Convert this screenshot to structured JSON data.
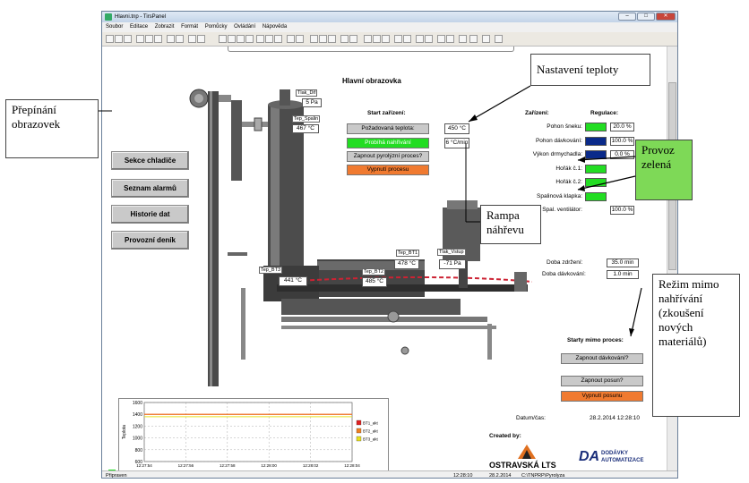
{
  "window": {
    "title": "Hlavni.tnp - TirsPanel"
  },
  "menu": [
    "Soubor",
    "Editace",
    "Zobrazit",
    "Formát",
    "Pomůcky",
    "Ovládání",
    "Nápověda"
  ],
  "screen_title": "Hlavní obrazovka",
  "nav_buttons": [
    "Sekce chladiče",
    "Seznam alarmů",
    "Historie dat",
    "Provozní deník"
  ],
  "start": {
    "heading": "Start zařízení:",
    "setpoint_label": "Požadovaná teplota:",
    "setpoint_value": "450 °C",
    "heating_label": "Probíhá nahřívání",
    "ramp_value": "6 °C/min",
    "pyrolysis_label": "Zapnout pyrolýzní proces?",
    "stop_label": "Vypnutí procesu"
  },
  "devices": {
    "col1": "Zařízení:",
    "col2": "Regulace:",
    "rows": [
      {
        "name": "Pohon šneku:",
        "state": "green",
        "value": "20.0 %"
      },
      {
        "name": "Pohon dávkování:",
        "state": "blue",
        "value": "100.0 %"
      },
      {
        "name": "Výkon drmychadla:",
        "state": "blue",
        "value": "0.0 %"
      },
      {
        "name": "Hořák č.1:",
        "state": "green",
        "value": ""
      },
      {
        "name": "Hořák č.2:",
        "state": "green",
        "value": ""
      },
      {
        "name": "Spalinová klapka:",
        "state": "green",
        "value": ""
      },
      {
        "name": "Spal. ventilátor:",
        "state": "",
        "value": "100.0 %"
      }
    ]
  },
  "times": {
    "hold_label": "Doba zdržení:",
    "hold_value": "35.0 min",
    "dose_label": "Doba dávkování:",
    "dose_value": "1.0 min"
  },
  "sensors": {
    "tlak_dif": "Tlak_Dif",
    "tlak_dif_value": "5 Pa",
    "tep_spalin": "Tep_Spalin",
    "tep_spalin_value": "467 °C",
    "tep_bt3": "Tep_BT3",
    "tep_bt3_value": "441 °C",
    "tep_bt2": "Tep_BT2",
    "tep_bt2_value": "485 °C",
    "tep_bt1": "Tep_BT1",
    "tep_bt1_value": "478 °C",
    "tlak_vstup": "Tlak_Vstup",
    "tlak_vstup_value": "-71 Pa"
  },
  "off_process": {
    "heading": "Starty mimo proces:",
    "dose_btn": "Zapnout dávkování?",
    "shift_btn": "Zapnout posun?",
    "stop_shift_btn": "Vypnutí posunu"
  },
  "datetime": {
    "label": "Datum/čas:",
    "value": "28.2.2014 12:28:10"
  },
  "created_by": "Created by:",
  "logos": {
    "l1": "OSTRAVSKÁ LTS",
    "l2a": "DODÁVKY",
    "l2b": "AUTOMATIZACE"
  },
  "chart_data": {
    "type": "line",
    "ylabel": "Teplota",
    "ylim": [
      600,
      1600
    ],
    "yticks": [
      "600",
      "800",
      "1000",
      "1200",
      "1400",
      "1600"
    ],
    "xticks": [
      "12:27:54",
      "12:27:56",
      "12:27:58",
      "12:28:00",
      "12:28:02",
      "12:28:04"
    ],
    "series": [
      {
        "name": "BT1_akt",
        "color": "#e02020",
        "values": [
          1400,
          1400,
          1400,
          1400,
          1400,
          1400
        ]
      },
      {
        "name": "BT2_akt",
        "color": "#f08020",
        "values": [
          1400,
          1400,
          1400,
          1400,
          1400,
          1400
        ]
      },
      {
        "name": "BT3_akt",
        "color": "#e8e020",
        "values": [
          1360,
          1360,
          1360,
          1360,
          1360,
          1360
        ]
      }
    ]
  },
  "statusbar": {
    "left": "Připraven",
    "time": "12:28:10",
    "date": "28.2.2014",
    "path": "C:\\TNPRP\\Pyrolyza"
  },
  "callouts": {
    "switch": "Přepínání obrazovek",
    "temp": "Nastavení teploty",
    "green": "Provoz zelená",
    "ramp": "Rampa náhřevu",
    "mode": "Režim mimo nahřívání (zkoušení nových materiálů)"
  },
  "colors": {
    "green": "#22dd22",
    "blue": "#0a2a8a",
    "orange": "#f07a30",
    "button_gray": "#c9c9c9"
  }
}
